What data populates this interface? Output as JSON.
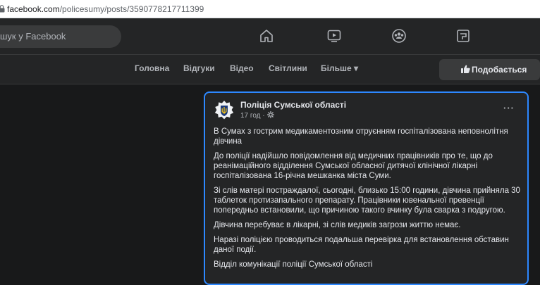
{
  "browser": {
    "url_host": "facebook.com",
    "url_path": "/policesumy/posts/3590778217711399"
  },
  "topnav": {
    "search_placeholder": "шук у Facebook",
    "icons": [
      "home-icon",
      "video-icon",
      "groups-icon",
      "gaming-icon"
    ]
  },
  "page_tabs": {
    "items": [
      "Головна",
      "Відгуки",
      "Відео",
      "Світлини",
      "Більше ▾"
    ],
    "like_label": "Подобається"
  },
  "post": {
    "author": "Поліція Сумської області",
    "time": "17 год ·",
    "more": "···",
    "paragraphs": [
      "В Сумах з гострим медикаментозним отруєнням госпіталізована неповнолітня дівчина",
      "До поліції надійшло повідомлення від медичних працівників про те, що до реанімаційного відділення Сумської обласної дитячої клінічної лікарні госпіталізована 16-річна мешканка міста Суми.",
      "Зі слів матері постраждалої, сьогодні, близько 15:00 години, дівчина прийняла 30 таблеток протизапального препарату. Працівники ювенальної превенції попередньо встановили, що причиною такого вчинку була сварка з подругою.",
      "Дівчина перебуває в лікарні, зі слів медиків загрози життю немає.",
      "Наразі поліцією проводиться подальша перевірка для встановлення обставин даної події.",
      "Відділ комунікації поліції Сумської області"
    ]
  },
  "colors": {
    "accent": "#2d88ff",
    "background": "#18191a",
    "surface": "#242526"
  }
}
